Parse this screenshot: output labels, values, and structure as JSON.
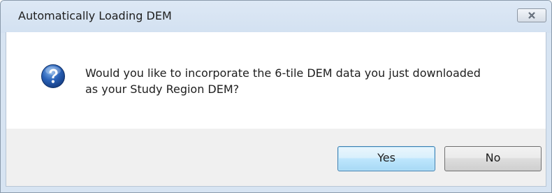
{
  "dialog": {
    "title": "Automatically Loading DEM",
    "message_line1": "Would you like to incorporate the 6-tile DEM data you just downloaded",
    "message_line2": "as your Study Region DEM?",
    "icon": "question-icon",
    "yes_label": "Yes",
    "no_label": "No",
    "close_icon": "close-icon"
  },
  "colors": {
    "titlebar": "#d3e1f1",
    "icon_blue": "#2a62b8",
    "default_button_border": "#3c7fb1"
  }
}
